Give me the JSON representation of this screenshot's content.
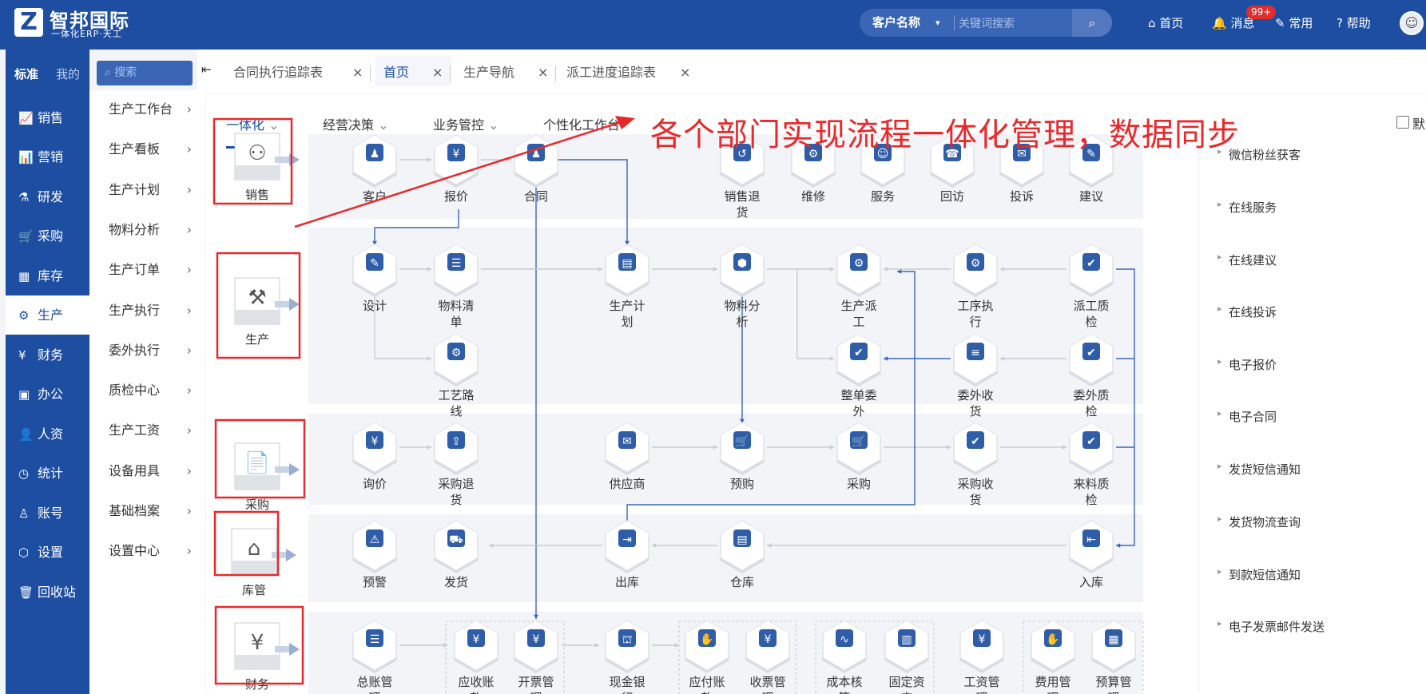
{
  "app": {
    "logo_char": "Z",
    "name": "智邦国际",
    "sub": "一体化ERP·天工"
  },
  "search": {
    "category": "客户名称",
    "caret": "▾",
    "placeholder": "关键词搜索",
    "icon": "search-icon"
  },
  "top_nav": {
    "home": "⌂ 首页",
    "messages": "🔔 消息",
    "badge": "99+",
    "common": "✎ 常用",
    "help": "? 帮助"
  },
  "sidebar": {
    "tab_standard": "标准",
    "tab_mine": "我的",
    "search_placeholder": "搜索",
    "items": [
      {
        "icon": "📈",
        "label": "销售"
      },
      {
        "icon": "📊",
        "label": "营销"
      },
      {
        "icon": "⚗",
        "label": "研发"
      },
      {
        "icon": "🛒",
        "label": "采购"
      },
      {
        "icon": "▦",
        "label": "库存"
      },
      {
        "icon": "⚙",
        "label": "生产"
      },
      {
        "icon": "¥",
        "label": "财务"
      },
      {
        "icon": "▣",
        "label": "办公"
      },
      {
        "icon": "👤",
        "label": "人资"
      },
      {
        "icon": "◷",
        "label": "统计"
      },
      {
        "icon": "♙",
        "label": "账号"
      },
      {
        "icon": "⬡",
        "label": "设置"
      },
      {
        "icon": "🗑",
        "label": "回收站"
      }
    ]
  },
  "submenu": [
    "生产工作台",
    "生产看板",
    "生产计划",
    "物料分析",
    "生产订单",
    "生产执行",
    "委外执行",
    "质检中心",
    "生产工资",
    "设备用具",
    "基础档案",
    "设置中心"
  ],
  "page_tabs": [
    {
      "label": "合同执行追踪表"
    },
    {
      "label": "首页"
    },
    {
      "label": "生产导航"
    },
    {
      "label": "派工进度追踪表"
    }
  ],
  "sub_tabs": [
    "一体化",
    "经营决策",
    "业务管控",
    "个性化工作台"
  ],
  "banner": "各个部门实现流程一体化管理，数据同步",
  "default_label": "默",
  "lanes": [
    {
      "label": "销售",
      "icon": "⚇"
    },
    {
      "label": "生产",
      "icon": "⚒"
    },
    {
      "label": "采购",
      "icon": "📄"
    },
    {
      "label": "库管",
      "icon": "⌂"
    },
    {
      "label": "财务",
      "icon": "¥"
    }
  ],
  "nodes": [
    {
      "label": "客户",
      "icon": "♟"
    },
    {
      "label": "报价",
      "icon": "¥"
    },
    {
      "label": "合同",
      "icon": "♟"
    },
    {
      "label": "销售退\n货",
      "icon": "↺"
    },
    {
      "label": "维修",
      "icon": "⚙"
    },
    {
      "label": "服务",
      "icon": "☺"
    },
    {
      "label": "回访",
      "icon": "☎"
    },
    {
      "label": "投诉",
      "icon": "✉"
    },
    {
      "label": "建议",
      "icon": "✎"
    },
    {
      "label": "设计",
      "icon": "✎"
    },
    {
      "label": "物料清\n单",
      "icon": "☰"
    },
    {
      "label": "生产计\n划",
      "icon": "▤"
    },
    {
      "label": "物料分\n析",
      "icon": "⬢"
    },
    {
      "label": "生产派\n工",
      "icon": "⚙"
    },
    {
      "label": "工序执\n行",
      "icon": "⚙"
    },
    {
      "label": "派工质\n检",
      "icon": "✔"
    },
    {
      "label": "工艺路\n线",
      "icon": "⚙"
    },
    {
      "label": "整单委\n外",
      "icon": "✔"
    },
    {
      "label": "委外收\n货",
      "icon": "≡"
    },
    {
      "label": "委外质\n检",
      "icon": "✔"
    },
    {
      "label": "询价",
      "icon": "¥"
    },
    {
      "label": "采购退\n货",
      "icon": "⇪"
    },
    {
      "label": "供应商",
      "icon": "✉"
    },
    {
      "label": "预购",
      "icon": "🛒"
    },
    {
      "label": "采购",
      "icon": "🛒"
    },
    {
      "label": "采购收\n货",
      "icon": "✔"
    },
    {
      "label": "来料质\n检",
      "icon": "✔"
    },
    {
      "label": "预警",
      "icon": "⚠"
    },
    {
      "label": "发货",
      "icon": "⛟"
    },
    {
      "label": "出库",
      "icon": "⇥"
    },
    {
      "label": "仓库",
      "icon": "▤"
    },
    {
      "label": "入库",
      "icon": "⇤"
    },
    {
      "label": "总账管\n理",
      "icon": "☰"
    },
    {
      "label": "应收账\n款",
      "icon": "¥"
    },
    {
      "label": "开票管\n理",
      "icon": "¥"
    },
    {
      "label": "现金银\n行",
      "icon": "⛫"
    },
    {
      "label": "应付账\n款",
      "icon": "✋"
    },
    {
      "label": "收票管\n理",
      "icon": "¥"
    },
    {
      "label": "成本核\n算",
      "icon": "∿"
    },
    {
      "label": "固定资\n产",
      "icon": "▥"
    },
    {
      "label": "工资管\n理",
      "icon": "¥"
    },
    {
      "label": "费用管\n理",
      "icon": "✋"
    },
    {
      "label": "预算管\n理",
      "icon": "▦"
    }
  ],
  "right_panel": [
    "微信粉丝获客",
    "在线服务",
    "在线建议",
    "在线投诉",
    "电子报价",
    "电子合同",
    "发货短信通知",
    "发货物流查询",
    "到款短信通知",
    "电子发票邮件发送"
  ],
  "colors": {
    "brand": "#1d4ea2",
    "accent_red": "#e8292c",
    "node_icon": "#2f5da8"
  }
}
